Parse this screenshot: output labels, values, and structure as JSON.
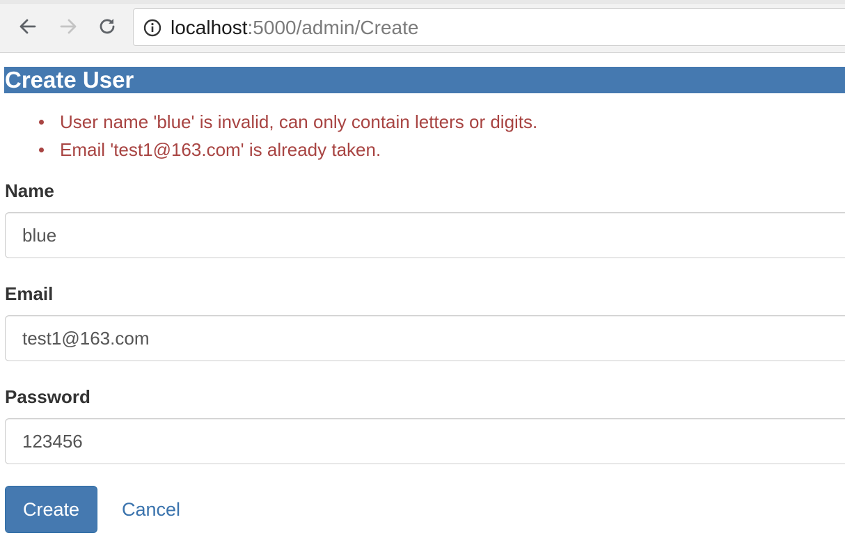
{
  "browser": {
    "url_host": "localhost",
    "url_path": ":5000/admin/Create"
  },
  "page": {
    "title": "Create User"
  },
  "errors": [
    "User name 'blue' is invalid, can only contain letters or digits.",
    "Email 'test1@163.com' is already taken."
  ],
  "form": {
    "name_label": "Name",
    "name_value": "blue",
    "email_label": "Email",
    "email_value": "test1@163.com",
    "password_label": "Password",
    "password_value": "123456",
    "create_label": "Create",
    "cancel_label": "Cancel"
  },
  "colors": {
    "header_bg": "#4579b0",
    "error_text": "#a84442",
    "link": "#3a73ad"
  },
  "icons": [
    "back-arrow-icon",
    "forward-arrow-icon",
    "reload-icon",
    "info-icon"
  ]
}
